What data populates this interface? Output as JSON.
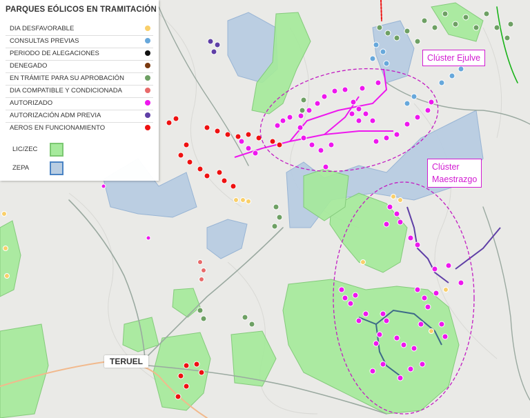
{
  "legend": {
    "title": "PARQUES EÓLICOS EN TRAMITACIÓN",
    "items": [
      {
        "label": "DIA DESFAVORABLE",
        "color": "#f9cf6a"
      },
      {
        "label": "CONSULTAS PREVIAS",
        "color": "#67a8db"
      },
      {
        "label": "PERIODO DE ALEGACIONES",
        "color": "#111111"
      },
      {
        "label": "DENEGADO",
        "color": "#7a3a10"
      },
      {
        "label": "EN TRÁMITE PARA SU APROBACIÓN",
        "color": "#6ea064"
      },
      {
        "label": "DIA COMPATIBLE Y CONDICIONADA",
        "color": "#e86a6a"
      },
      {
        "label": "AUTORIZADO",
        "color": "#ee17ee"
      },
      {
        "label": "AUTORIZACIÓN ADM PREVIA",
        "color": "#5f3fa6"
      },
      {
        "label": "AEROS EN FUNCIONAMIENTO",
        "color": "#ee1111"
      }
    ],
    "areas": [
      {
        "label": "LIC/ZEC",
        "fill": "#a6ea9c",
        "stroke": "#7cc872"
      },
      {
        "label": "ZEPA",
        "fill": "#b9cde2",
        "stroke": "#4a83c4"
      }
    ]
  },
  "clusters": {
    "ejulve": "Clúster Ejulve",
    "maestrazgo_line1": "Clúster",
    "maestrazgo_line2": "Maestrazgo"
  },
  "city": "TERUEL",
  "colors": {
    "autorizado": "#ee17ee",
    "funcionamiento": "#ee1111",
    "tramite": "#6ea064",
    "consultas": "#67a8db",
    "desfavorable": "#f9cf6a",
    "compatible": "#e86a6a",
    "adm_previa": "#5f3fa6",
    "lic": "#a6ea9c",
    "zepa": "#b9cde2",
    "cluster_ellipse": "#c21bc2"
  }
}
